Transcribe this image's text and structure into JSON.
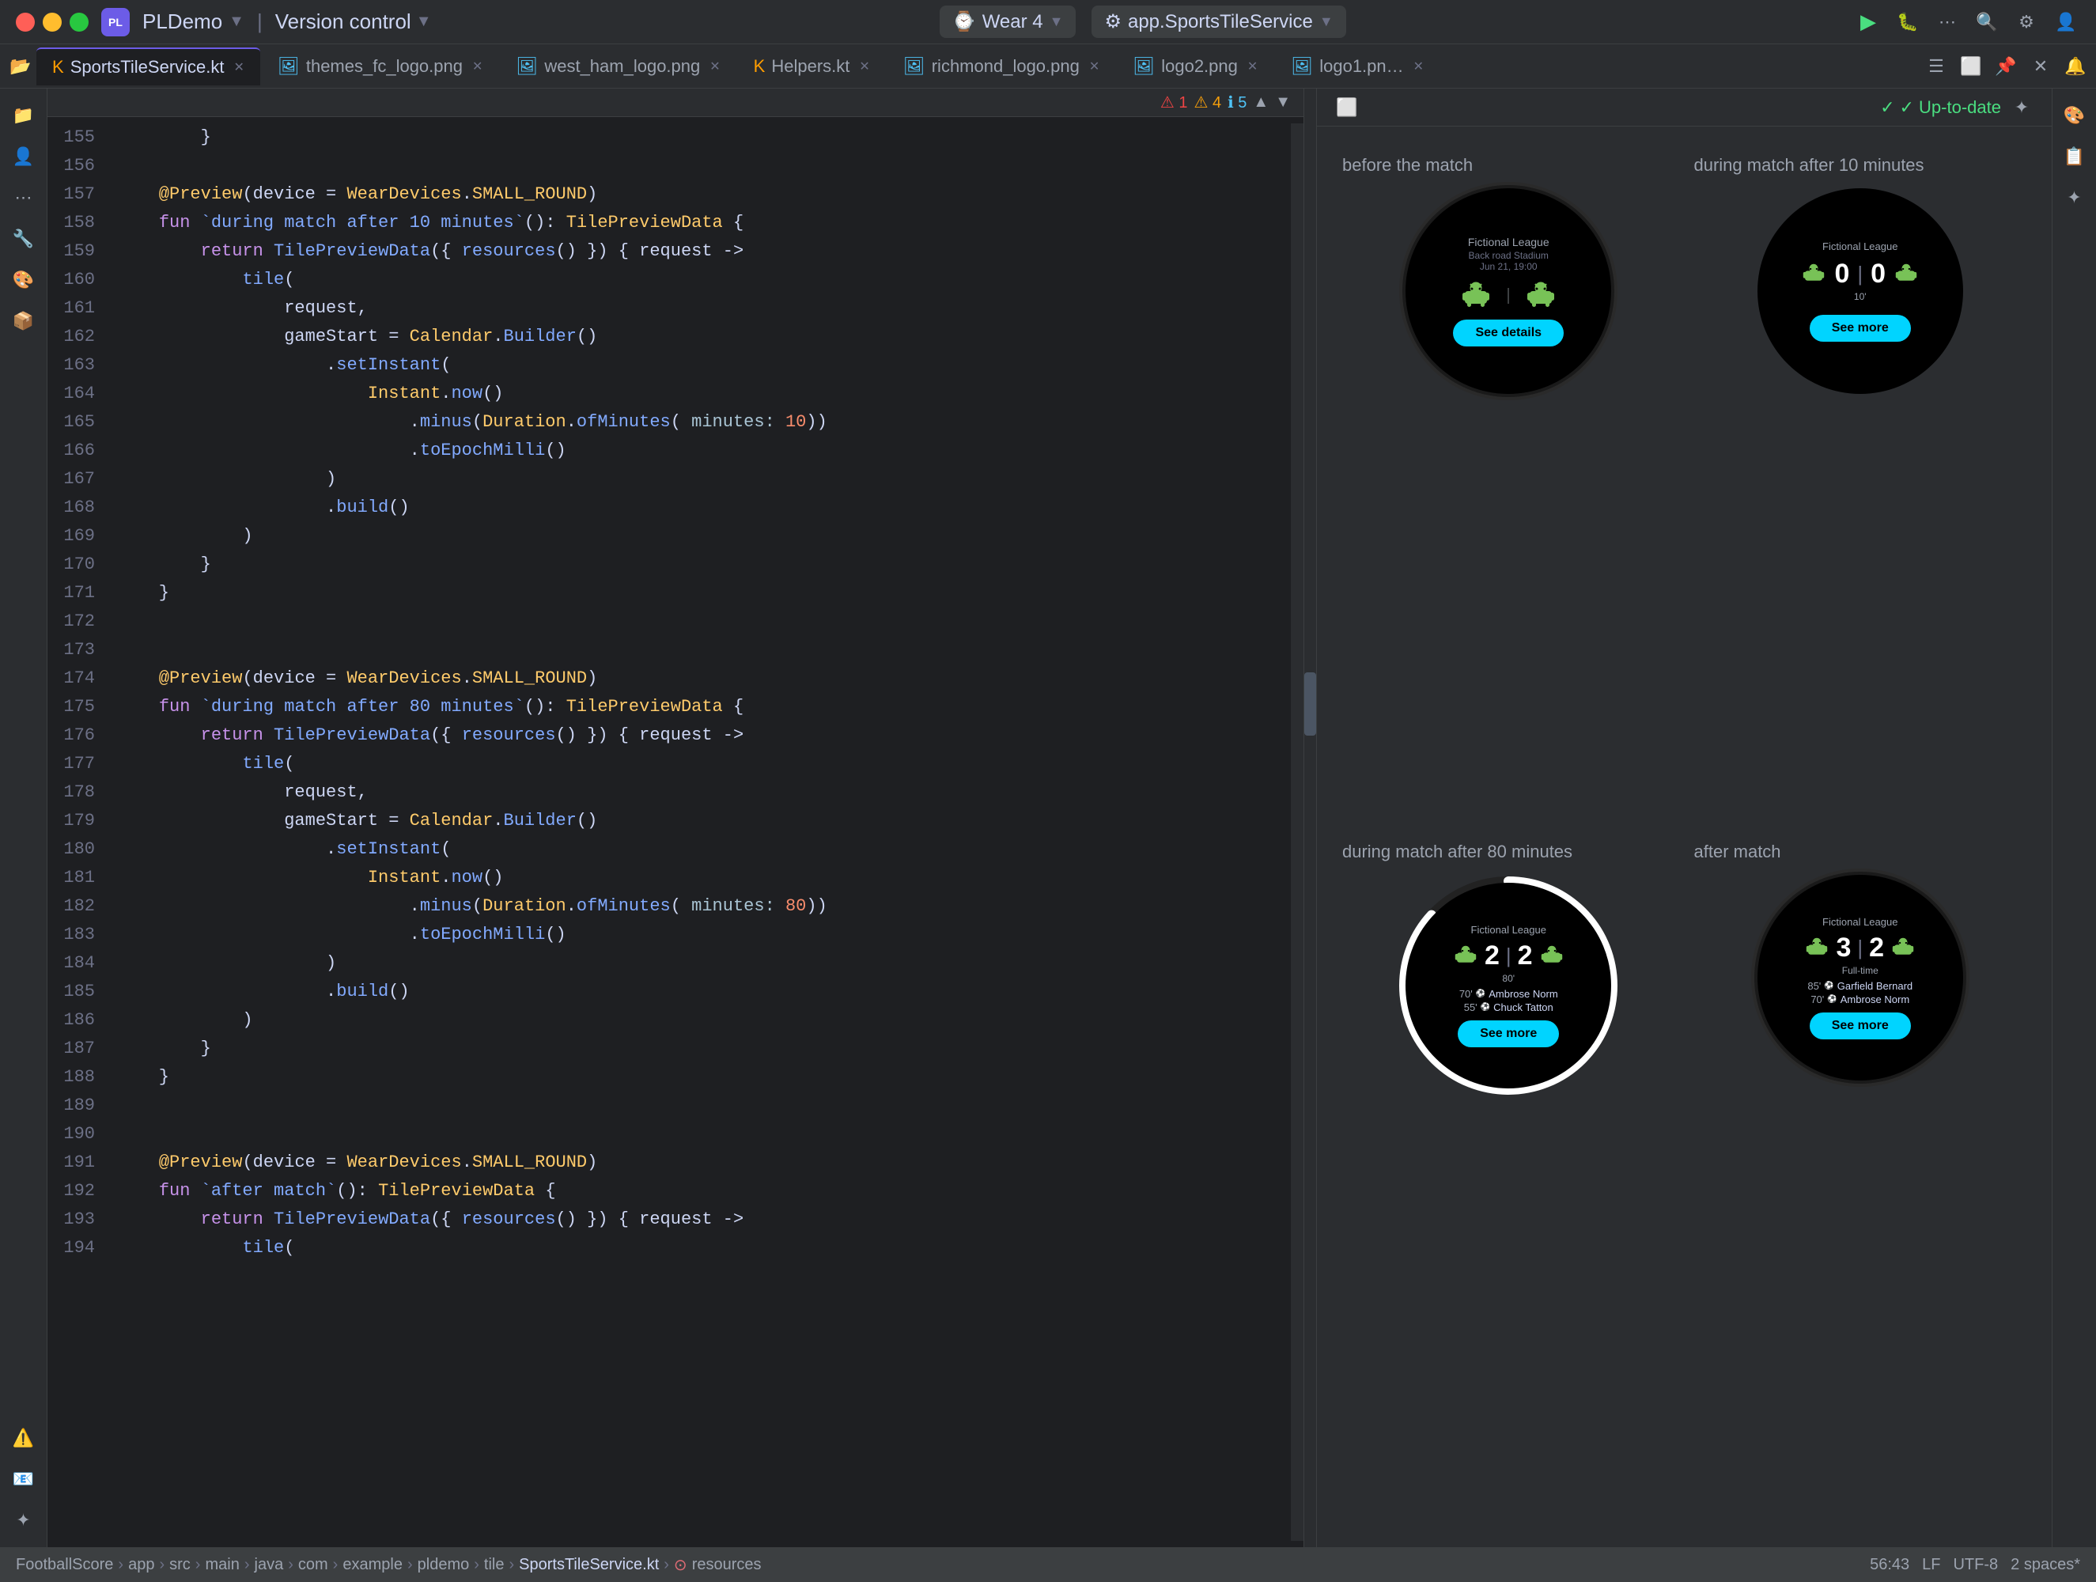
{
  "titlebar": {
    "traffic_lights": [
      "red",
      "yellow",
      "green"
    ],
    "logo": "PL",
    "project_name": "PLDemo",
    "version_control": "Version control",
    "device_icon": "📱",
    "device_name": "Wear 4",
    "service_icon": "🔧",
    "service_name": "app.SportsTileService",
    "run_icon": "▶",
    "debug_icon": "🐞",
    "more_icon": "⋯"
  },
  "tabs": [
    {
      "id": "SportsTileService",
      "label": "SportsTileService.kt",
      "type": "kt",
      "active": true
    },
    {
      "id": "themes_fc_logo",
      "label": "themes_fc_logo.png",
      "type": "png",
      "active": false
    },
    {
      "id": "west_ham_logo",
      "label": "west_ham_logo.png",
      "type": "png",
      "active": false
    },
    {
      "id": "Helpers",
      "label": "Helpers.kt",
      "type": "kt",
      "active": false
    },
    {
      "id": "richmond_logo",
      "label": "richmond_logo.png",
      "type": "png",
      "active": false
    },
    {
      "id": "logo2",
      "label": "logo2.png",
      "type": "png",
      "active": false
    },
    {
      "id": "logo1",
      "label": "logo1.pn…",
      "type": "png",
      "active": false
    }
  ],
  "warnings": {
    "errors": "1",
    "warnings": "4",
    "infos": "5"
  },
  "code": {
    "lines": [
      {
        "num": "155",
        "text": "        }"
      },
      {
        "num": "156",
        "text": ""
      },
      {
        "num": "157",
        "text": "    @Preview(device = WearDevices.SMALL_ROUND)",
        "annotation": true
      },
      {
        "num": "158",
        "text": "    fun `during match after 10 minutes`(): TilePreviewData {"
      },
      {
        "num": "159",
        "text": "        return TilePreviewData({ resources() }) { request ->"
      },
      {
        "num": "160",
        "text": "            tile("
      },
      {
        "num": "161",
        "text": "                request,"
      },
      {
        "num": "162",
        "text": "                gameStart = Calendar.Builder()"
      },
      {
        "num": "163",
        "text": "                    .setInstant("
      },
      {
        "num": "164",
        "text": "                        Instant.now()"
      },
      {
        "num": "165",
        "text": "                            .minus(Duration.ofMinutes( minutes: 10))",
        "highlight": false,
        "has_param": true,
        "param_label": "minutes:",
        "param_val": "10"
      },
      {
        "num": "166",
        "text": "                            .toEpochMilli()"
      },
      {
        "num": "167",
        "text": "                    )"
      },
      {
        "num": "168",
        "text": "                    .build()"
      },
      {
        "num": "169",
        "text": "            )"
      },
      {
        "num": "170",
        "text": "        }"
      },
      {
        "num": "171",
        "text": "    }"
      },
      {
        "num": "172",
        "text": ""
      },
      {
        "num": "173",
        "text": ""
      },
      {
        "num": "174",
        "text": "    @Preview(device = WearDevices.SMALL_ROUND)",
        "annotation": true
      },
      {
        "num": "175",
        "text": "    fun `during match after 80 minutes`(): TilePreviewData {"
      },
      {
        "num": "176",
        "text": "        return TilePreviewData({ resources() }) { request ->"
      },
      {
        "num": "177",
        "text": "            tile("
      },
      {
        "num": "178",
        "text": "                request,"
      },
      {
        "num": "179",
        "text": "                gameStart = Calendar.Builder()"
      },
      {
        "num": "180",
        "text": "                    .setInstant("
      },
      {
        "num": "181",
        "text": "                        Instant.now()"
      },
      {
        "num": "182",
        "text": "                            .minus(Duration.ofMinutes( minutes: 80))",
        "highlight": false,
        "has_param": true,
        "param_label": "minutes:",
        "param_val": "80"
      },
      {
        "num": "183",
        "text": "                            .toEpochMilli()"
      },
      {
        "num": "184",
        "text": "                    )"
      },
      {
        "num": "185",
        "text": "                    .build()"
      },
      {
        "num": "186",
        "text": "            )"
      },
      {
        "num": "187",
        "text": "        }"
      },
      {
        "num": "188",
        "text": "    }"
      },
      {
        "num": "189",
        "text": ""
      },
      {
        "num": "190",
        "text": ""
      },
      {
        "num": "191",
        "text": "    @Preview(device = WearDevices.SMALL_ROUND)",
        "annotation": true
      },
      {
        "num": "192",
        "text": "    fun `after match`(): TilePreviewData {"
      },
      {
        "num": "193",
        "text": "        return TilePreviewData({ resources() }) { request ->"
      },
      {
        "num": "194",
        "text": "            tile("
      }
    ]
  },
  "preview": {
    "uptodate": "✓ Up-to-date",
    "cells": [
      {
        "id": "before-match",
        "label": "before the match",
        "league": "Fictional League",
        "venue": "Back road Stadium",
        "date": "Jun 21, 19:00",
        "score": null,
        "minute": null,
        "button": "See details",
        "type": "pre",
        "scorers": []
      },
      {
        "id": "during-10",
        "label": "during match after 10 minutes",
        "league": "Fictional League",
        "score_home": "0",
        "score_away": "0",
        "minute": "10'",
        "button": "See more",
        "type": "live-early",
        "scorers": []
      },
      {
        "id": "during-80",
        "label": "during match after 80 minutes",
        "league": "Fictional League",
        "score_home": "2",
        "score_away": "2",
        "minute": "80'",
        "button": "See more",
        "type": "live-late",
        "scorers": [
          {
            "min": "70'",
            "name": "Ambrose Norm"
          },
          {
            "min": "55'",
            "name": "Chuck Tatton"
          }
        ]
      },
      {
        "id": "after-match",
        "label": "after match",
        "league": "Fictional League",
        "score_home": "3",
        "score_away": "2",
        "minute": "Full-time",
        "button": "See more",
        "type": "fulltime",
        "scorers": [
          {
            "min": "85'",
            "name": "Garfield Bernard"
          },
          {
            "min": "70'",
            "name": "Ambrose Norm"
          }
        ]
      }
    ]
  },
  "statusbar": {
    "breadcrumb": [
      "FootballScore",
      "app",
      "src",
      "main",
      "java",
      "com",
      "example",
      "pldemo",
      "tile",
      "SportsTileService.kt",
      "resources"
    ],
    "position": "56:43",
    "encoding": "LF",
    "charset": "UTF-8",
    "indent": "2 spaces*"
  },
  "sidebar": {
    "items": [
      "📁",
      "👤",
      "⋯",
      "🔧",
      "🎨",
      "📦",
      "⚠️",
      "📧",
      "↕"
    ]
  }
}
